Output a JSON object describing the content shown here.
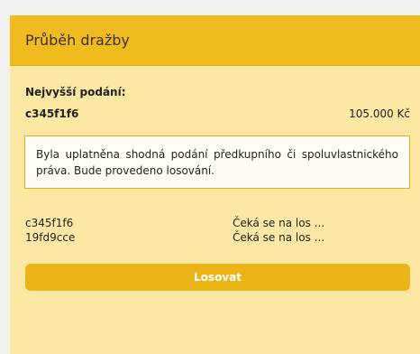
{
  "panel": {
    "title": "Průběh dražby"
  },
  "highest_bid": {
    "label": "Nejvyšší podání:",
    "bidder": "c345f1f6",
    "amount": "105.000 Kč"
  },
  "notice": {
    "text": "Byla uplatněna shodná podání předkupního či spoluvlastnického práva. Bude provedeno losování."
  },
  "lots": [
    {
      "bidder": "c345f1f6",
      "status": "Čeká se na los ..."
    },
    {
      "bidder": "19fd9cce",
      "status": "Čeká se na los ..."
    }
  ],
  "actions": {
    "draw_label": "Losovat"
  },
  "colors": {
    "header_bg": "#f0bb1f",
    "panel_bg": "#fde8a3",
    "button_bg": "#ebb517",
    "notice_border": "#e3b021"
  }
}
